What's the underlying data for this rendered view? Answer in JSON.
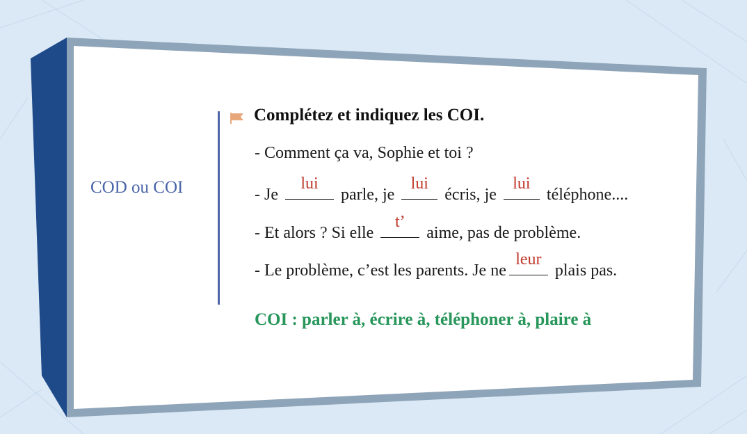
{
  "side_label": "COD ou COI",
  "heading": "Complétez et indiquez les COI.",
  "lines": [
    {
      "parts": [
        "- Comment ça va, Sophie et toi ?"
      ]
    },
    {
      "p1": "- Je ",
      "a1": "lui",
      "p2": " parle, je ",
      "a2": "lui",
      "p3": " écris, je ",
      "a3": "lui",
      "p4": " téléphone...."
    },
    {
      "p1": "- Et alors ? Si elle ",
      "a1": "t’",
      "p2": " aime, pas de problème."
    },
    {
      "p1": "- Le problème, c’est les parents. Je ne",
      "a1": "leur",
      "p2": " plais pas."
    }
  ],
  "coi_summary": "COI :  parler à, écrire à, téléphoner à, plaire à",
  "colors": {
    "background": "#dbe9f6",
    "frame_left": "#1f4a8a",
    "frame_border": "#8ea4b8",
    "side_label": "#4a64a8",
    "answer": "#c0392b",
    "summary": "#27965a",
    "flag": "#e8a77a"
  }
}
